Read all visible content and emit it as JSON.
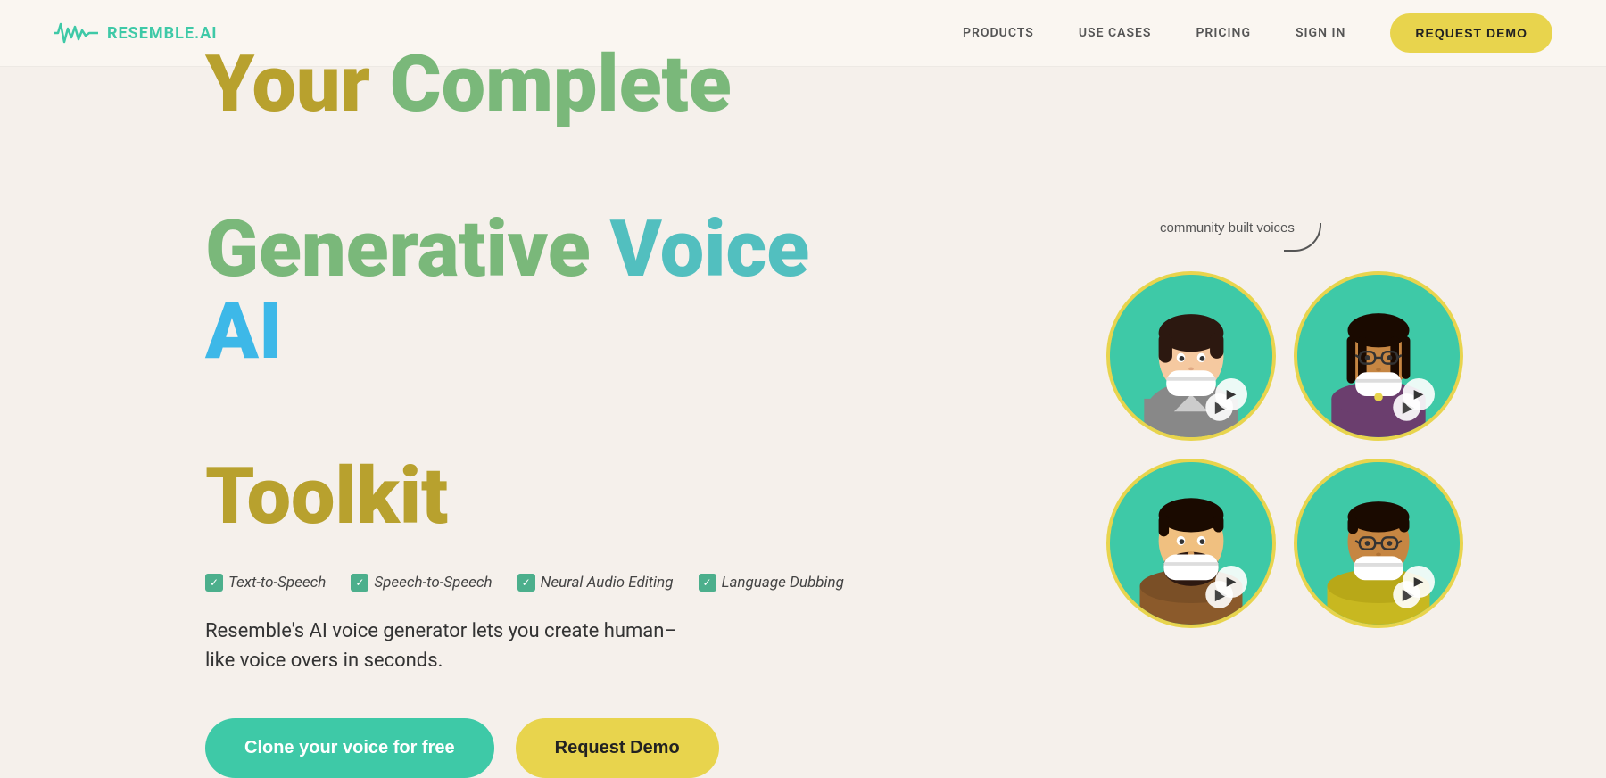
{
  "navbar": {
    "logo_wave": "∿∿∿",
    "logo_text": "RESEMBLE.AI",
    "nav_items": [
      {
        "label": "PRODUCTS",
        "id": "products"
      },
      {
        "label": "USE CASES",
        "id": "use-cases"
      },
      {
        "label": "PRICING",
        "id": "pricing"
      },
      {
        "label": "SIGN IN",
        "id": "sign-in"
      }
    ],
    "cta_label": "REQUEST DEMO"
  },
  "hero": {
    "title": {
      "word_your": "Your",
      "word_complete": "Complete",
      "word_generative": "Generative",
      "word_voice": "Voice",
      "word_ai": "AI",
      "word_toolkit": "Toolkit"
    },
    "features": [
      "Text-to-Speech",
      "Speech-to-Speech",
      "Neural Audio Editing",
      "Language Dubbing"
    ],
    "description": "Resemble's AI voice generator lets you create human–like voice overs in seconds.",
    "btn_clone": "Clone your voice for free",
    "btn_demo": "Request Demo",
    "community_label": "community built voices"
  },
  "colors": {
    "primary_teal": "#3ec9a7",
    "primary_yellow": "#e8d44d",
    "title_gold": "#b8a12e",
    "title_green": "#7ab87a",
    "title_teal": "#52bfbf",
    "title_blue": "#3db8e8",
    "bg": "#f5f0eb"
  }
}
